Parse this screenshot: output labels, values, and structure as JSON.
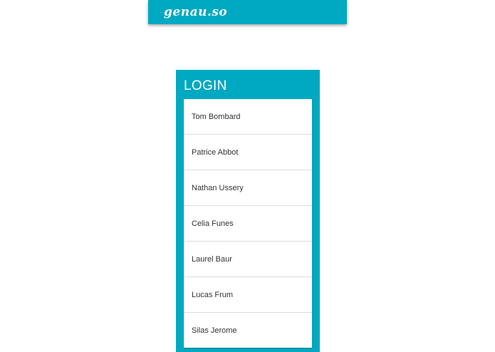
{
  "header": {
    "brand": "genau.so"
  },
  "login": {
    "title": "LOGIN",
    "users": [
      {
        "name": "Tom Bombard"
      },
      {
        "name": "Patrice Abbot"
      },
      {
        "name": "Nathan Ussery"
      },
      {
        "name": "Celia Funes"
      },
      {
        "name": "Laurel Baur"
      },
      {
        "name": "Lucas Frum"
      },
      {
        "name": "Silas Jerome"
      }
    ]
  },
  "colors": {
    "accent": "#00a9c2",
    "text": "#333333",
    "divider": "#dcdcdc"
  }
}
